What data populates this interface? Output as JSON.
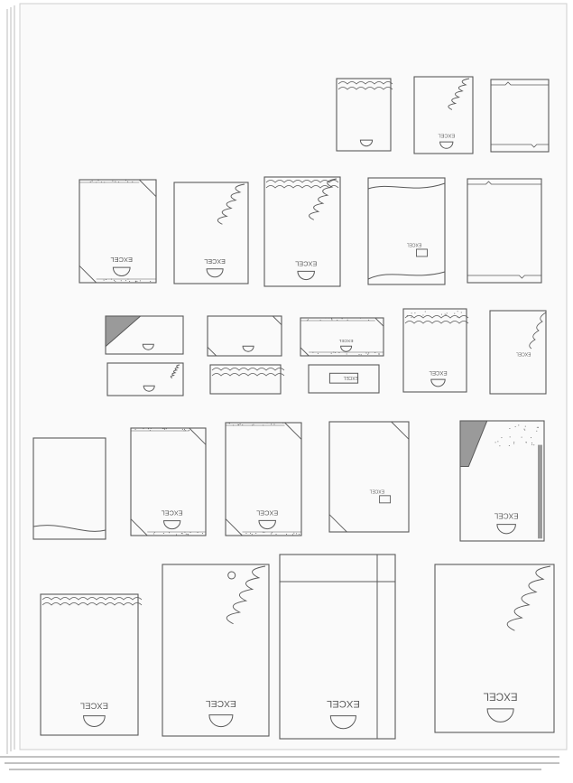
{
  "page": {
    "label_word": "EXCEL",
    "paper_color": "#f9f9f9",
    "pencil_color": "#5a5a5a",
    "shade_color": "#9a9a9a"
  },
  "thumbnails": [
    {
      "id": "r1-a",
      "design": "waves-top",
      "logo": "smile"
    },
    {
      "id": "r1-b",
      "design": "leaf-corner",
      "logo": "smile-label"
    },
    {
      "id": "r1-c",
      "design": "frame-brackets",
      "logo": "none"
    },
    {
      "id": "r2-a",
      "design": "dotted-corners",
      "logo": "smile-label"
    },
    {
      "id": "r2-b",
      "design": "leaf-right",
      "logo": "smile-label"
    },
    {
      "id": "r2-c",
      "design": "waves-top-leaf",
      "logo": "smile-label"
    },
    {
      "id": "r2-d",
      "design": "curve-bands",
      "logo": "box-label"
    },
    {
      "id": "r2-e",
      "design": "frame-brackets",
      "logo": "none"
    },
    {
      "id": "r3-a",
      "design": "shaded-triangle",
      "logo": "smile"
    },
    {
      "id": "r3-b",
      "design": "corner-lines",
      "logo": "smile"
    },
    {
      "id": "r3-c",
      "design": "dotted-corners",
      "logo": "smile-label"
    },
    {
      "id": "r3-d",
      "design": "dotted-top",
      "logo": "smile-label"
    },
    {
      "id": "r3-e",
      "design": "waves-right",
      "logo": "label"
    },
    {
      "id": "r3-f",
      "design": "leaf-corner",
      "logo": "smile"
    },
    {
      "id": "r3-g",
      "design": "waves-top",
      "logo": "none"
    },
    {
      "id": "r3-h",
      "design": "pill-label",
      "logo": "label"
    },
    {
      "id": "r4-a",
      "design": "bottom-curve",
      "logo": "none"
    },
    {
      "id": "r4-b",
      "design": "dotted-corners-sun",
      "logo": "smile-label"
    },
    {
      "id": "r4-c",
      "design": "dotted-corners",
      "logo": "smile-label"
    },
    {
      "id": "r4-d",
      "design": "corner-lines",
      "logo": "box-label"
    },
    {
      "id": "r4-e",
      "design": "shaded-dotted-top",
      "logo": "label-smile"
    },
    {
      "id": "r5-a",
      "design": "waves-top",
      "logo": "smile-label"
    },
    {
      "id": "r5-b",
      "design": "leaf-circle",
      "logo": "smile-label"
    },
    {
      "id": "r5-c",
      "design": "frame-strips",
      "logo": "smile-label"
    },
    {
      "id": "r5-d",
      "design": "leaf-right",
      "logo": "smile-label"
    }
  ]
}
